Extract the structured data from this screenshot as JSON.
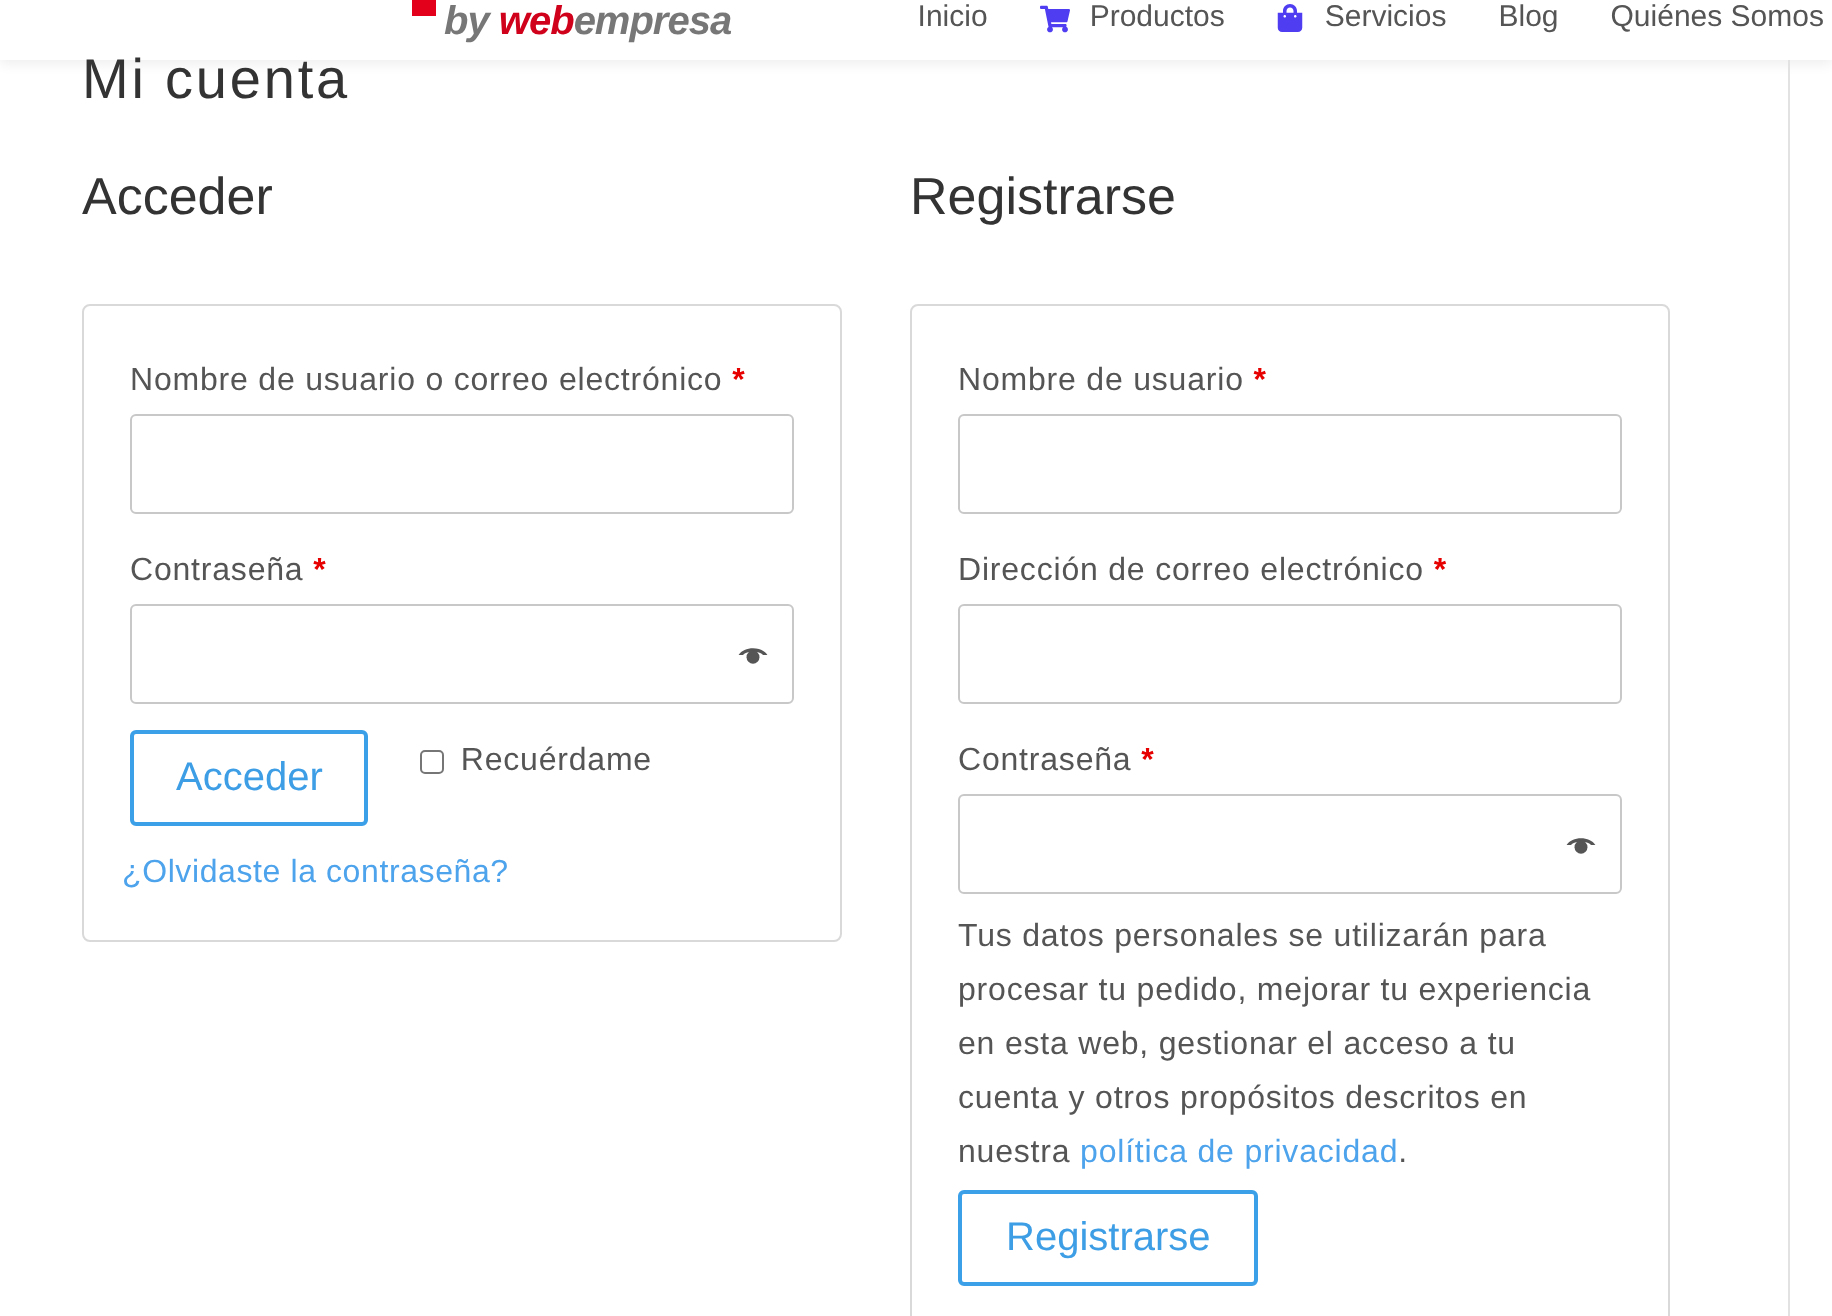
{
  "header": {
    "logo": {
      "lead": "by",
      "accent": "web",
      "tail": "empresa"
    },
    "nav": [
      {
        "label": "Inicio",
        "kind": "plain"
      },
      {
        "label": "Productos",
        "kind": "cart"
      },
      {
        "label": "Servicios",
        "kind": "bag"
      },
      {
        "label": "Blog",
        "kind": "plain"
      },
      {
        "label": "Quiénes Somos",
        "kind": "plain"
      }
    ]
  },
  "page_title": "Mi cuenta",
  "login": {
    "title": "Acceder",
    "fields": [
      {
        "label": "Nombre de usuario o correo electrónico",
        "required_mark": "*",
        "kind": "text"
      },
      {
        "label": "Contraseña",
        "required_mark": "*",
        "kind": "password"
      }
    ],
    "submit": "Acceder",
    "remember": {
      "label": "Recuérdame",
      "checked": false
    },
    "lost_password": "¿Olvidaste la contraseña?"
  },
  "register": {
    "title": "Registrarse",
    "fields": [
      {
        "label": "Nombre de usuario",
        "required_mark": "*",
        "kind": "text"
      },
      {
        "label": "Dirección de correo electrónico",
        "required_mark": "*",
        "kind": "email"
      },
      {
        "label": "Contraseña",
        "required_mark": "*",
        "kind": "password"
      }
    ],
    "privacy_notice": {
      "text": "Tus datos personales se utilizarán para procesar tu pedido, mejorar tu experiencia en esta web, gestionar el acceso a tu cuenta y otros propósitos descritos en nuestra ",
      "link": "política de privacidad",
      "after": "."
    },
    "submit": "Registrarse"
  }
}
